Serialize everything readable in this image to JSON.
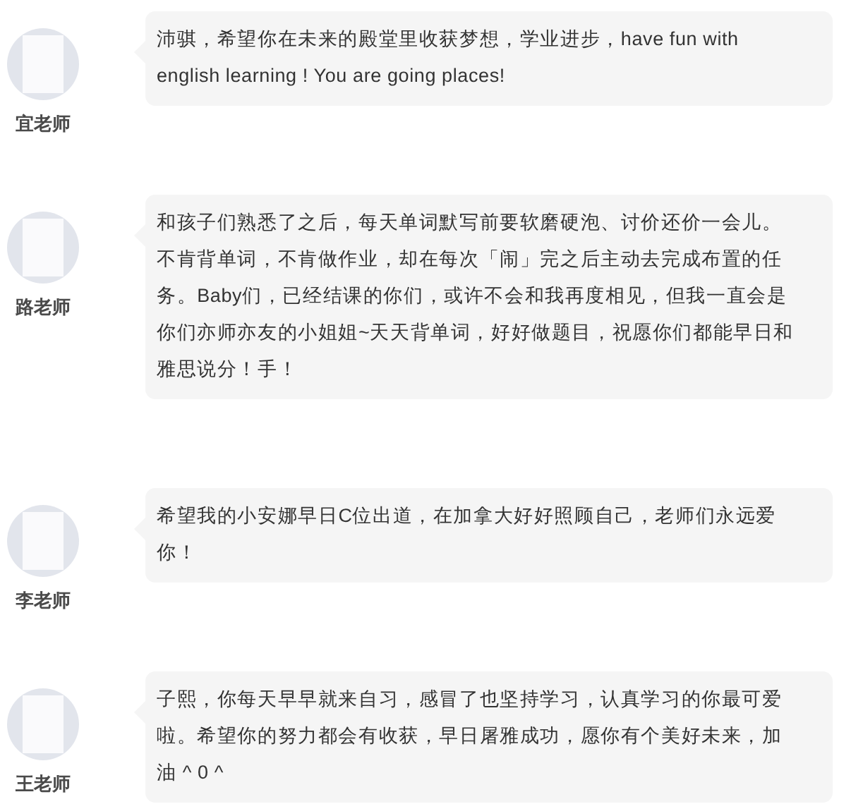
{
  "messages": [
    {
      "teacher": "宜老师",
      "text": "沛骐，希望你在未来的殿堂里收获梦想，学业进步，have fun with english learning ! You are going places!"
    },
    {
      "teacher": "路老师",
      "text": "和孩子们熟悉了之后，每天单词默写前要软磨硬泡、讨价还价一会儿。不肯背单词，不肯做作业，却在每次「闹」完之后主动去完成布置的任务。Baby们，已经结课的你们，或许不会和我再度相见，但我一直会是你们亦师亦友的小姐姐~天天背单词，好好做题目，祝愿你们都能早日和雅思说分！手！"
    },
    {
      "teacher": "李老师",
      "text": "希望我的小安娜早日C位出道，在加拿大好好照顾自己，老师们永远爱你！"
    },
    {
      "teacher": "王老师",
      "text": "子熙，你每天早早就来自习，感冒了也坚持学习，认真学习的你最可爱啦。希望你的努力都会有收获，早日屠雅成功，愿你有个美好未来，加油 ^ 0 ^"
    }
  ]
}
